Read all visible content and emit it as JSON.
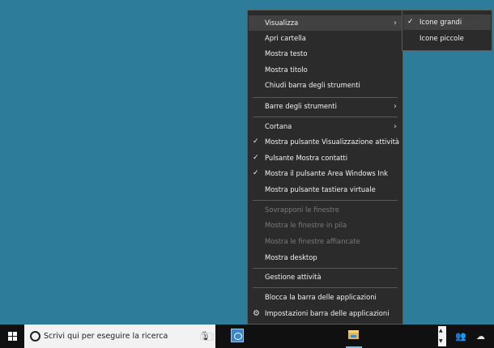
{
  "menu": {
    "items": [
      {
        "label": "Visualizza"
      },
      {
        "label": "Apri cartella"
      },
      {
        "label": "Mostra testo"
      },
      {
        "label": "Mostra titolo"
      },
      {
        "label": "Chiudi barra degli strumenti"
      },
      {
        "label": "Barre degli strumenti"
      },
      {
        "label": "Cortana"
      },
      {
        "label": "Mostra pulsante Visualizzazione attività"
      },
      {
        "label": "Pulsante Mostra contatti"
      },
      {
        "label": "Mostra il pulsante Area Windows Ink"
      },
      {
        "label": "Mostra pulsante tastiera virtuale"
      },
      {
        "label": "Sovrapponi le finestre"
      },
      {
        "label": "Mostra le finestre in pila"
      },
      {
        "label": "Mostra le finestre affiancate"
      },
      {
        "label": "Mostra desktop"
      },
      {
        "label": "Gestione attività"
      },
      {
        "label": "Blocca la barra delle applicazioni"
      },
      {
        "label": "Impostazioni barra delle applicazioni"
      }
    ],
    "check_glyph": "✓",
    "arrow_glyph": "›",
    "gear_glyph": "⚙"
  },
  "submenu": {
    "items": [
      {
        "label": "Icone grandi"
      },
      {
        "label": "Icone piccole"
      }
    ]
  },
  "taskbar": {
    "search_placeholder": "Scrivi qui per eseguire la ricerca",
    "mic_glyph": "🎙",
    "people_glyph": "👥",
    "cloud_glyph": "☁",
    "icons": [
      "windows-start-icon",
      "cortana-circle-icon",
      "microphone-icon",
      "task-view-icon",
      "pinned-app-icon",
      "file-explorer-icon",
      "tray-overflow-icon",
      "people-icon",
      "onedrive-cloud-icon"
    ]
  },
  "colors": {
    "desktop": "#2d7d9a",
    "menu_bg": "#2b2b2b",
    "menu_highlight": "#414141",
    "taskbar_bg": "#101010",
    "disabled_text": "#7a7a7a"
  }
}
